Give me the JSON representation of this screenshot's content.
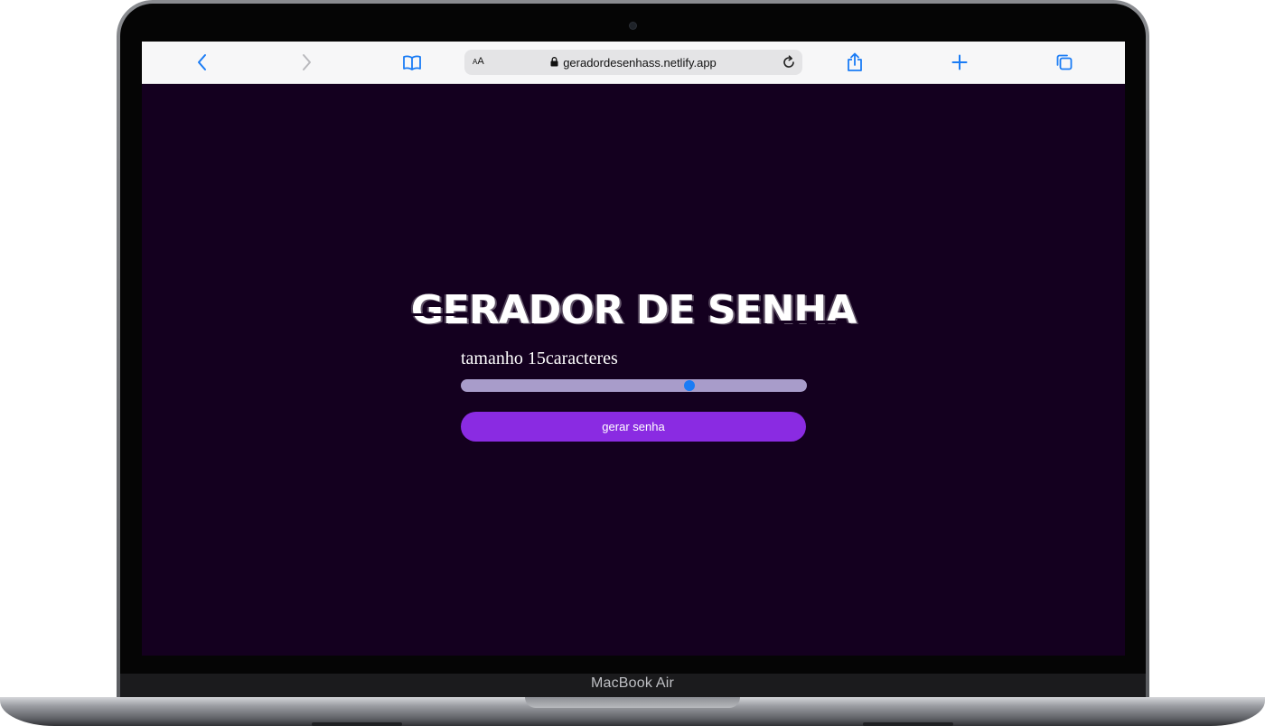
{
  "browser": {
    "text_size_label": "AA",
    "url": "geradordesenhass.netlify.app"
  },
  "page": {
    "title": "GERADOR DE SENHA",
    "size_label_prefix": "tamanho ",
    "size_value": "15",
    "size_label_suffix": "caracteres",
    "slider_fraction": 0.66,
    "button_label": "gerar senha"
  },
  "device": {
    "model_label": "MacBook Air"
  },
  "colors": {
    "page_background": "#14001f",
    "slider_track": "#a89cca",
    "slider_thumb": "#1a7cf5",
    "button": "#8a2be2",
    "toolbar_icons": "#1a7cf5"
  }
}
